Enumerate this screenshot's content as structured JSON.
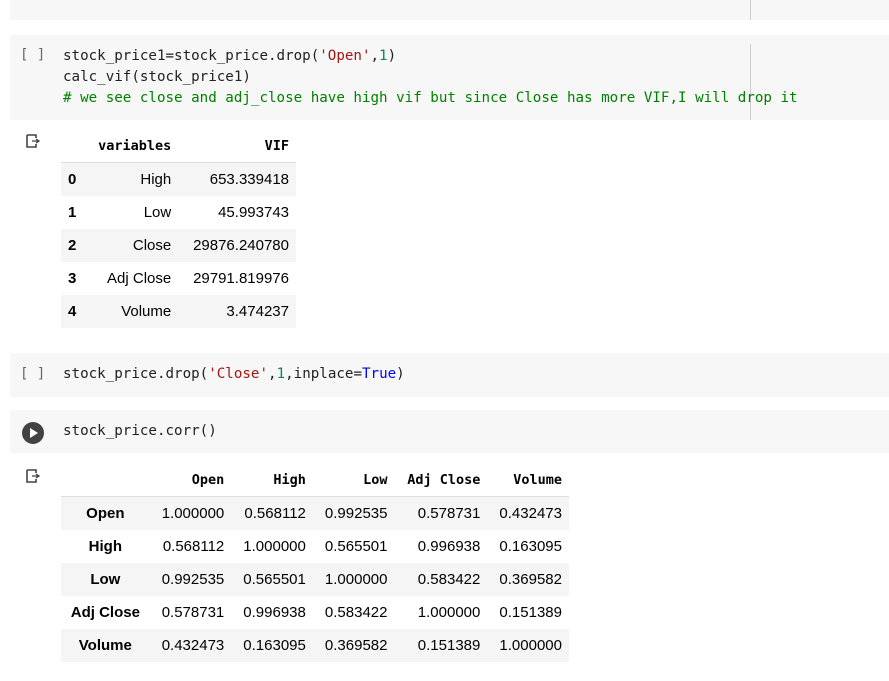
{
  "cells": [
    {
      "prompt": "[ ]",
      "lines": [
        [
          {
            "t": "stock_price1=stock_price.drop("
          },
          {
            "t": "'Open'",
            "c": "str"
          },
          {
            "t": ","
          },
          {
            "t": "1",
            "c": "num"
          },
          {
            "t": ")"
          }
        ],
        [
          {
            "t": "calc_vif(stock_price1)"
          }
        ],
        [
          {
            "t": "# we see close and adj_close have high vif but since Close has more VIF,I will drop it",
            "c": "cm"
          }
        ]
      ]
    },
    {
      "prompt": "[ ]",
      "lines": [
        [
          {
            "t": "stock_price.drop("
          },
          {
            "t": "'Close'",
            "c": "str"
          },
          {
            "t": ","
          },
          {
            "t": "1",
            "c": "num"
          },
          {
            "t": ",inplace="
          },
          {
            "t": "True",
            "c": "kw"
          },
          {
            "t": ")"
          }
        ]
      ]
    },
    {
      "prompt": "run",
      "lines": [
        [
          {
            "t": "stock_price.corr()"
          }
        ]
      ]
    }
  ],
  "vif_table": {
    "columns": [
      "",
      "variables",
      "VIF"
    ],
    "rows": [
      [
        "0",
        "High",
        "653.339418"
      ],
      [
        "1",
        "Low",
        "45.993743"
      ],
      [
        "2",
        "Close",
        "29876.240780"
      ],
      [
        "3",
        "Adj Close",
        "29791.819976"
      ],
      [
        "4",
        "Volume",
        "3.474237"
      ]
    ]
  },
  "corr_table": {
    "columns": [
      "",
      "Open",
      "High",
      "Low",
      "Adj Close",
      "Volume"
    ],
    "rows": [
      [
        "Open",
        "1.000000",
        "0.568112",
        "0.992535",
        "0.578731",
        "0.432473"
      ],
      [
        "High",
        "0.568112",
        "1.000000",
        "0.565501",
        "0.996938",
        "0.163095"
      ],
      [
        "Low",
        "0.992535",
        "0.565501",
        "1.000000",
        "0.583422",
        "0.369582"
      ],
      [
        "Adj Close",
        "0.578731",
        "0.996938",
        "0.583422",
        "1.000000",
        "0.151389"
      ],
      [
        "Volume",
        "0.432473",
        "0.163095",
        "0.369582",
        "0.151389",
        "1.000000"
      ]
    ]
  }
}
